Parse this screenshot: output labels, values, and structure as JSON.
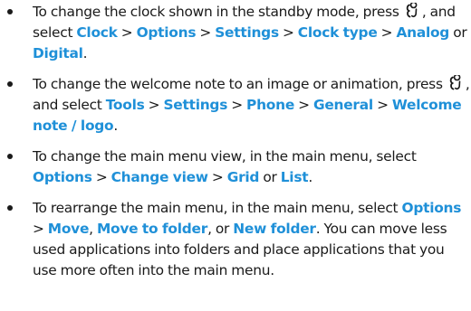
{
  "tips": [
    {
      "before_key": "To change the clock shown in the standby mode, press ",
      "after_key": ", and select ",
      "path": [
        "Clock",
        "Options",
        "Settings",
        "Clock type"
      ],
      "choice_a": "Analog",
      "conjunction": " or ",
      "choice_b": "Digital",
      "end": "."
    },
    {
      "before_key": "To change the welcome note to an image or animation, press ",
      "after_key": ", and select ",
      "path": [
        "Tools",
        "Settings",
        "Phone",
        "General",
        "Welcome note / logo"
      ],
      "end": "."
    },
    {
      "intro": "To change the main menu view, in the main menu, select ",
      "path": [
        "Options",
        "Change view"
      ],
      "choice_a": "Grid",
      "conjunction": " or ",
      "choice_b": "List",
      "end": "."
    },
    {
      "intro": "To rearrange the main menu, in the main menu, select ",
      "path": [
        "Options",
        "Move"
      ],
      "sep1": ", ",
      "option_2": "Move to folder",
      "sep2": ", or ",
      "option_3": "New folder",
      "end": ". You can move less used applications into folders and place applications that you use more often into the main menu."
    }
  ],
  "separator": " > ",
  "key_icon": "menu-key-icon",
  "colors": {
    "highlight": "#1f90d8",
    "text": "#1a1a1a"
  }
}
